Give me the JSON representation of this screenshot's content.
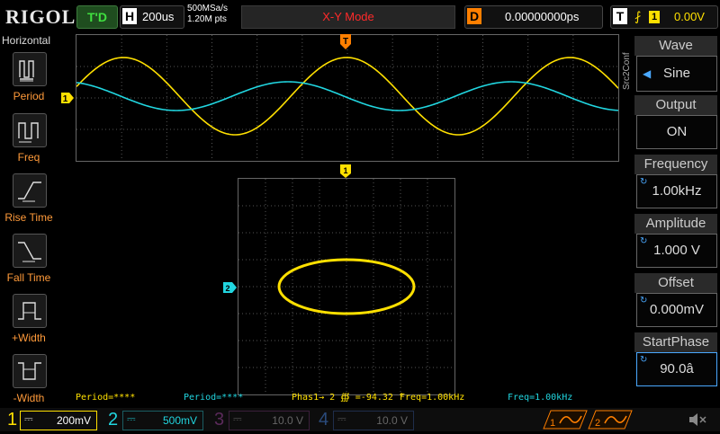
{
  "header": {
    "logo": "RIGOL",
    "run_status": "T'D",
    "timebase_tag": "H",
    "timebase": "200us",
    "sample_rate": "500MSa/s",
    "memory_depth": "1.20M pts",
    "mode": "X-Y Mode",
    "delay_tag": "D",
    "delay": "0.00000000ps",
    "trigger_tag": "T",
    "trigger_source": "1",
    "trigger_level": "0.00V"
  },
  "horizontal_menu": {
    "title": "Horizontal",
    "items": [
      {
        "label": "Period"
      },
      {
        "label": "Freq"
      },
      {
        "label": "Rise Time"
      },
      {
        "label": "Fall Time"
      },
      {
        "label": "+Width"
      },
      {
        "label": "-Width"
      }
    ]
  },
  "markers": {
    "trigger_pos": "T",
    "ch1_marker": "1",
    "ch1_top_marker": "1",
    "ch2_marker": "2"
  },
  "source_tab": "Src2Conf",
  "gen_menu": {
    "items": [
      {
        "title": "Wave",
        "value": "Sine"
      },
      {
        "title": "Output",
        "value": "ON"
      },
      {
        "title": "Frequency",
        "value": "1.00kHz"
      },
      {
        "title": "Amplitude",
        "value": "1.000 V"
      },
      {
        "title": "Offset",
        "value": "0.000mV"
      },
      {
        "title": "StartPhase",
        "value": "90.0â"
      }
    ]
  },
  "measurements": {
    "m1": "Period=****",
    "m2": "Period=****",
    "m3": "Phas1→ 2 ∰ =-94.32 °",
    "m4": "Freq=1.00kHz",
    "m5": "Freq=1.00kHz"
  },
  "channels": [
    {
      "num": "1",
      "scale": "200mV",
      "color": "#ffe000"
    },
    {
      "num": "2",
      "scale": "500mV",
      "color": "#21d6e0"
    },
    {
      "num": "3",
      "scale": "10.0 V",
      "color": "#b02ab0"
    },
    {
      "num": "4",
      "scale": "10.0 V",
      "color": "#2a6ad6"
    }
  ],
  "generators": [
    "1",
    "2"
  ],
  "colors": {
    "ch1": "#ffe000",
    "ch2": "#21d6e0",
    "accent": "#ff7f00",
    "knob": "#4aa8ff"
  }
}
